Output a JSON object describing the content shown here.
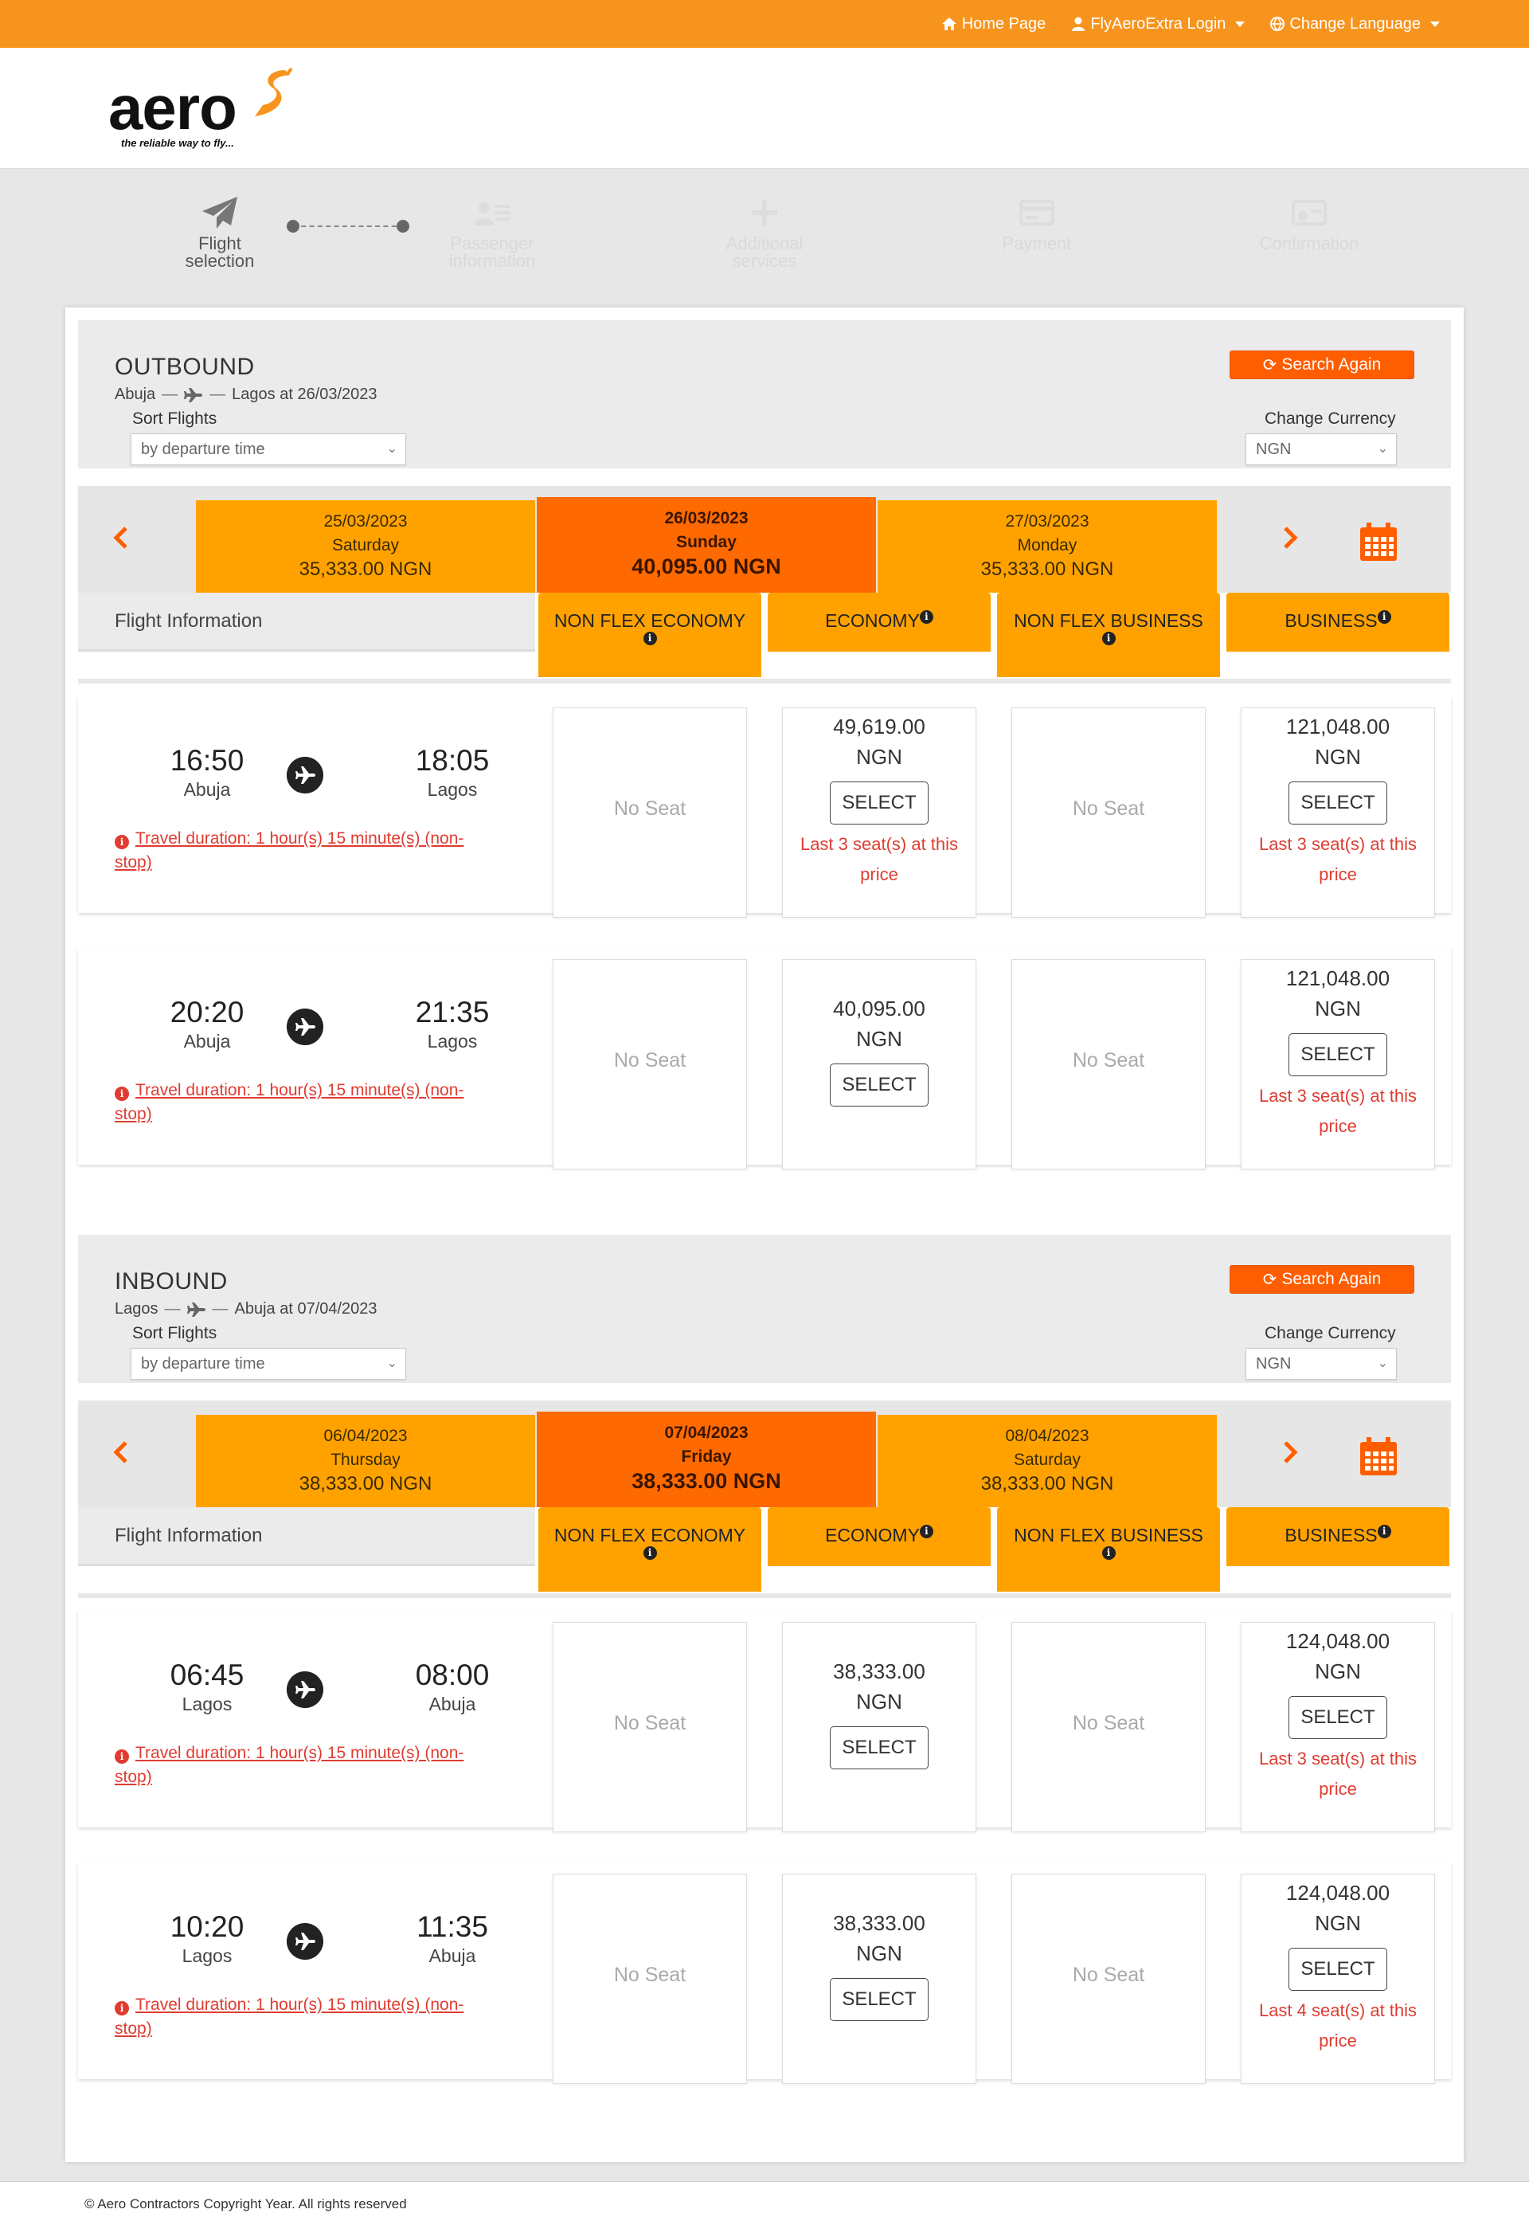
{
  "topbar": {
    "home": "Home Page",
    "login": "FlyAeroExtra Login",
    "language": "Change Language"
  },
  "logo": {
    "wordmark": "aero",
    "tagline": "the reliable way to fly..."
  },
  "steps": [
    {
      "label1": "Flight",
      "label2": "selection"
    },
    {
      "label1": "Passenger",
      "label2": "information"
    },
    {
      "label1": "Additional",
      "label2": "services"
    },
    {
      "label1": "Payment",
      "label2": ""
    },
    {
      "label1": "Confirmation",
      "label2": ""
    }
  ],
  "outbound": {
    "title": "OUTBOUND",
    "from": "Abuja",
    "to": "Lagos at 26/03/2023",
    "sort_label": "Sort Flights",
    "sort_value": "by departure time",
    "currency_label": "Change Currency",
    "currency_value": "NGN",
    "search_again": "Search Again",
    "dates": [
      {
        "date": "25/03/2023",
        "day": "Saturday",
        "price": "35,333.00 NGN"
      },
      {
        "date": "26/03/2023",
        "day": "Sunday",
        "price": "40,095.00 NGN"
      },
      {
        "date": "27/03/2023",
        "day": "Monday",
        "price": "35,333.00 NGN"
      }
    ],
    "flights": [
      {
        "dep_time": "16:50",
        "dep_city": "Abuja",
        "arr_time": "18:05",
        "arr_city": "Lagos",
        "duration": "Travel duration: 1 hour(s) 15 minute(s) (non-stop)",
        "nonflex_economy": "No Seat",
        "economy_price": "49,619.00",
        "economy_currency": "NGN",
        "economy_select": "SELECT",
        "economy_note": "Last 3 seat(s) at this price",
        "nonflex_business": "No Seat",
        "business_price": "121,048.00",
        "business_currency": "NGN",
        "business_select": "SELECT",
        "business_note": "Last 3 seat(s) at this price"
      },
      {
        "dep_time": "20:20",
        "dep_city": "Abuja",
        "arr_time": "21:35",
        "arr_city": "Lagos",
        "duration": "Travel duration: 1 hour(s) 15 minute(s) (non-stop)",
        "nonflex_economy": "No Seat",
        "economy_price": "40,095.00",
        "economy_currency": "NGN",
        "economy_select": "SELECT",
        "economy_note": "",
        "nonflex_business": "No Seat",
        "business_price": "121,048.00",
        "business_currency": "NGN",
        "business_select": "SELECT",
        "business_note": "Last 3 seat(s) at this price"
      }
    ]
  },
  "inbound": {
    "title": "INBOUND",
    "from": "Lagos",
    "to": "Abuja at 07/04/2023",
    "sort_label": "Sort Flights",
    "sort_value": "by departure time",
    "currency_label": "Change Currency",
    "currency_value": "NGN",
    "search_again": "Search Again",
    "dates": [
      {
        "date": "06/04/2023",
        "day": "Thursday",
        "price": "38,333.00 NGN"
      },
      {
        "date": "07/04/2023",
        "day": "Friday",
        "price": "38,333.00 NGN"
      },
      {
        "date": "08/04/2023",
        "day": "Saturday",
        "price": "38,333.00 NGN"
      }
    ],
    "flights": [
      {
        "dep_time": "06:45",
        "dep_city": "Lagos",
        "arr_time": "08:00",
        "arr_city": "Abuja",
        "duration": "Travel duration: 1 hour(s) 15 minute(s) (non-stop)",
        "nonflex_economy": "No Seat",
        "economy_price": "38,333.00",
        "economy_currency": "NGN",
        "economy_select": "SELECT",
        "economy_note": "",
        "nonflex_business": "No Seat",
        "business_price": "124,048.00",
        "business_currency": "NGN",
        "business_select": "SELECT",
        "business_note": "Last 3 seat(s) at this price"
      },
      {
        "dep_time": "10:20",
        "dep_city": "Lagos",
        "arr_time": "11:35",
        "arr_city": "Abuja",
        "duration": "Travel duration: 1 hour(s) 15 minute(s) (non-stop)",
        "nonflex_economy": "No Seat",
        "economy_price": "38,333.00",
        "economy_currency": "NGN",
        "economy_select": "SELECT",
        "economy_note": "",
        "nonflex_business": "No Seat",
        "business_price": "124,048.00",
        "business_currency": "NGN",
        "business_select": "SELECT",
        "business_note": "Last 4 seat(s) at this price"
      }
    ]
  },
  "columns": {
    "flight_info": "Flight Information",
    "nonflex_economy": "NON FLEX ECONOMY",
    "economy": "ECONOMY",
    "nonflex_business": "NON FLEX BUSINESS",
    "business": "BUSINESS"
  },
  "footer": {
    "copyright": "© Aero Contractors Copyright Year.",
    "rights": "All rights reserved"
  },
  "colors": {
    "topbar": "#f7941d",
    "tab": "#ffa200",
    "tab_selected": "#ff6a00",
    "search_button": "#ff5e00",
    "alert": "#e03c31"
  }
}
